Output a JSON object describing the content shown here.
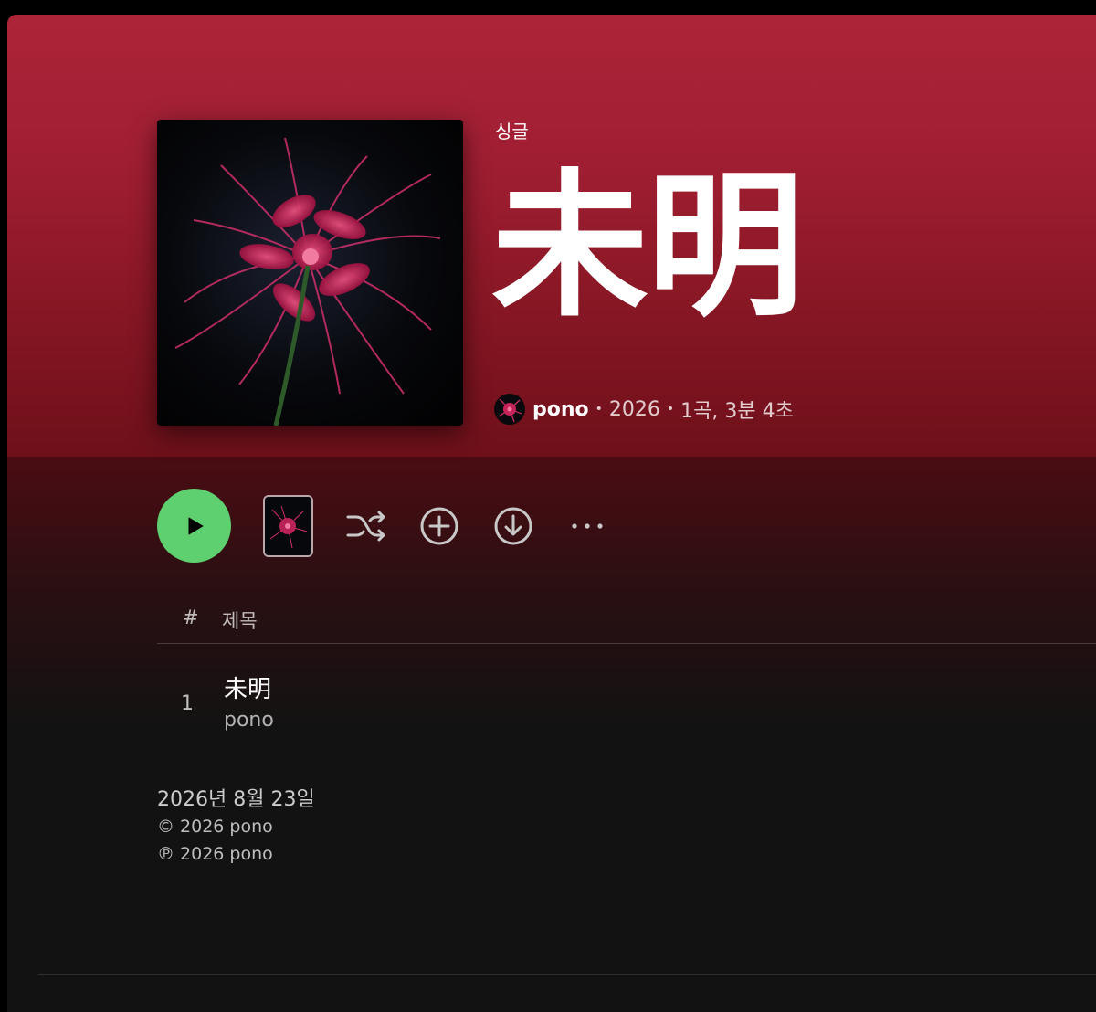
{
  "album": {
    "type_label": "싱글",
    "title": "未明",
    "artist": "pono",
    "year": "2026",
    "track_summary": "1곡, 3분 4초",
    "cover_icon": "red-spider-lily-artwork"
  },
  "actions": {
    "play_icon": "play-icon",
    "shuffle_icon": "shuffle-icon",
    "add_icon": "plus-circle-icon",
    "download_icon": "download-circle-icon",
    "more_label": "···"
  },
  "tracklist": {
    "hash_label": "#",
    "title_label": "제목",
    "tracks": [
      {
        "number": "1",
        "title": "未明",
        "artist": "pono"
      }
    ]
  },
  "release_info": {
    "date": "2026년 8월 23일",
    "copyright_c": "© 2026 pono",
    "copyright_p": "℗ 2026 pono"
  },
  "colors": {
    "hero_top": "#ac2438",
    "play_button": "#5ed06f",
    "background": "#121212"
  }
}
